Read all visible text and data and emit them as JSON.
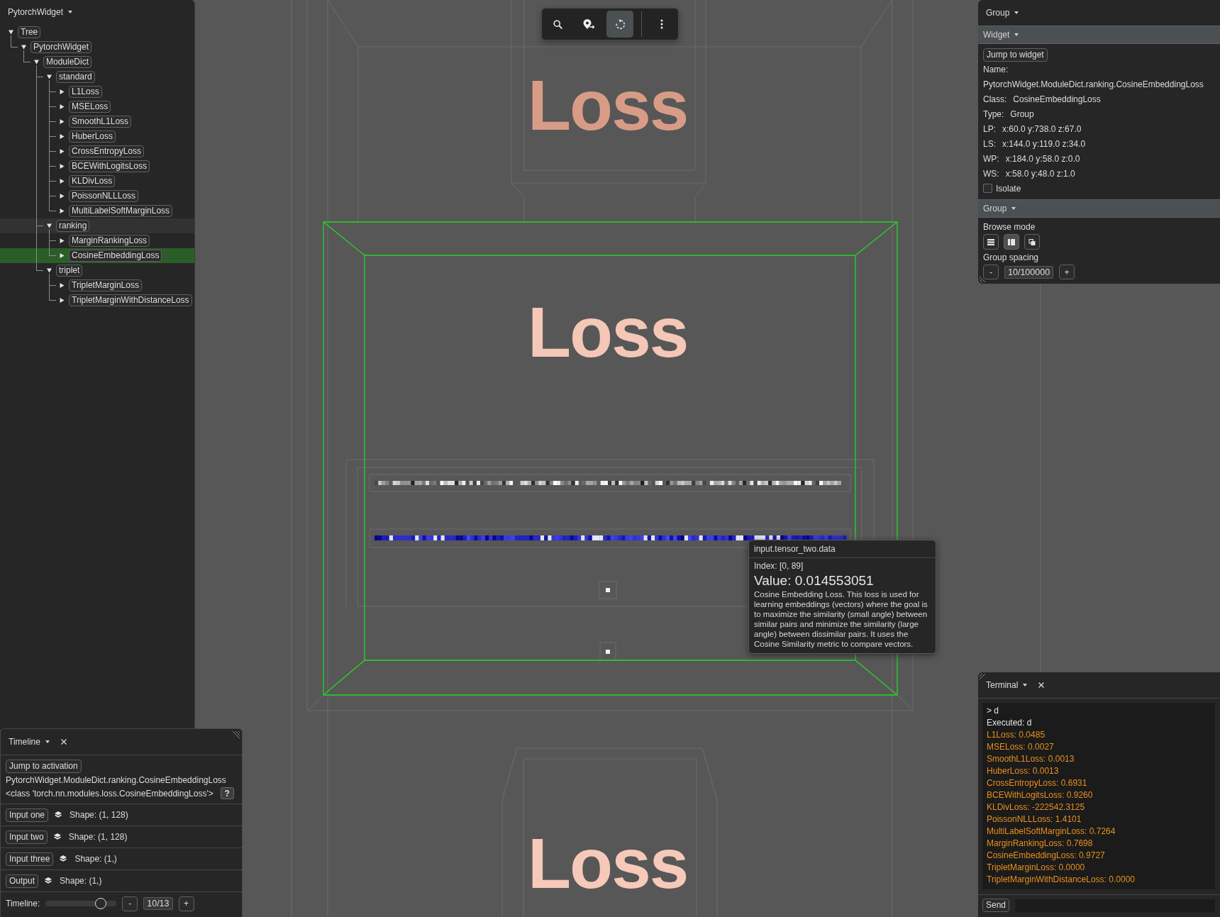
{
  "tree_panel": {
    "title": "PytorchWidget",
    "tree": [
      {
        "label": "Tree",
        "expanded": true,
        "selected": false,
        "hovered": false,
        "children": [
          {
            "label": "PytorchWidget",
            "expanded": true,
            "selected": false,
            "hovered": false,
            "children": [
              {
                "label": "ModuleDict",
                "expanded": true,
                "selected": false,
                "hovered": false,
                "children": [
                  {
                    "label": "standard",
                    "expanded": true,
                    "selected": false,
                    "hovered": false,
                    "children": [
                      {
                        "label": "L1Loss",
                        "expanded": false,
                        "selected": false,
                        "hovered": false
                      },
                      {
                        "label": "MSELoss",
                        "expanded": false,
                        "selected": false,
                        "hovered": false
                      },
                      {
                        "label": "SmoothL1Loss",
                        "expanded": false,
                        "selected": false,
                        "hovered": false
                      },
                      {
                        "label": "HuberLoss",
                        "expanded": false,
                        "selected": false,
                        "hovered": false
                      },
                      {
                        "label": "CrossEntropyLoss",
                        "expanded": false,
                        "selected": false,
                        "hovered": false
                      },
                      {
                        "label": "BCEWithLogitsLoss",
                        "expanded": false,
                        "selected": false,
                        "hovered": false
                      },
                      {
                        "label": "KLDivLoss",
                        "expanded": false,
                        "selected": false,
                        "hovered": false
                      },
                      {
                        "label": "PoissonNLLLoss",
                        "expanded": false,
                        "selected": false,
                        "hovered": false
                      },
                      {
                        "label": "MultiLabelSoftMarginLoss",
                        "expanded": false,
                        "selected": false,
                        "hovered": false
                      }
                    ]
                  },
                  {
                    "label": "ranking",
                    "expanded": true,
                    "selected": false,
                    "hovered": true,
                    "children": [
                      {
                        "label": "MarginRankingLoss",
                        "expanded": false,
                        "selected": false,
                        "hovered": false
                      },
                      {
                        "label": "CosineEmbeddingLoss",
                        "expanded": false,
                        "selected": true,
                        "hovered": false
                      }
                    ]
                  },
                  {
                    "label": "triplet",
                    "expanded": true,
                    "selected": false,
                    "hovered": false,
                    "children": [
                      {
                        "label": "TripletMarginLoss",
                        "expanded": false,
                        "selected": false,
                        "hovered": false
                      },
                      {
                        "label": "TripletMarginWithDistanceLoss",
                        "expanded": false,
                        "selected": false,
                        "hovered": false
                      }
                    ]
                  }
                ]
              }
            ]
          }
        ]
      }
    ]
  },
  "toolbar": {
    "tools": [
      {
        "selected": false
      },
      {
        "selected": false
      },
      {
        "selected": true
      }
    ]
  },
  "viewport": {
    "labels": [
      {
        "text": "Loss",
        "color": "#d89c86"
      },
      {
        "text": "Loss",
        "color": "#f4c7b7"
      },
      {
        "text": "Loss",
        "color": "#f6c9b9"
      }
    ],
    "tooltip": {
      "title": "input.tensor_two.data",
      "index": "Index: [0, 89]",
      "value": "Value: 0.014553051",
      "description": "Cosine Embedding Loss. This loss is used for learning embeddings (vectors) where the goal is to maximize the similarity (small angle) between similar pairs and minimize the similarity (large angle) between dissimilar pairs. It uses the Cosine Similarity metric to compare vectors."
    }
  },
  "inspector": {
    "title": "Group",
    "widget_section": {
      "title": "Widget",
      "expanded": true,
      "jump_button": "Jump to widget",
      "name_label": "Name:",
      "name_value": "PytorchWidget.ModuleDict.ranking.CosineEmbeddingLoss",
      "properties": [
        {
          "label": "Class:",
          "value": "CosineEmbeddingLoss"
        },
        {
          "label": "Type:",
          "value": "Group"
        },
        {
          "label": "LP:",
          "value": "x:60.0 y:738.0 z:67.0"
        },
        {
          "label": "LS:",
          "value": "x:144.0 y:119.0 z:34.0"
        },
        {
          "label": "WP:",
          "value": "x:184.0 y:58.0 z:0.0"
        },
        {
          "label": "WS:",
          "value": "x:58.0 y:48.0 z:1.0"
        }
      ],
      "isolate": {
        "label": "Isolate",
        "checked": false
      }
    },
    "group_section": {
      "title": "Group",
      "expanded": true,
      "browse_mode_label": "Browse mode",
      "browse_modes": [
        {
          "selected": false
        },
        {
          "selected": true
        },
        {
          "selected": false
        }
      ],
      "spacing_label": "Group spacing",
      "spacing_decrement": "-",
      "spacing_value": "10/100000",
      "spacing_increment": "+"
    }
  },
  "timeline": {
    "title": "Timeline",
    "jump_button": "Jump to activation",
    "module_path": "PytorchWidget.ModuleDict.ranking.CosineEmbeddingLoss",
    "class_text": "<class 'torch.nn.modules.loss.CosineEmbeddingLoss'>",
    "help_button": "?",
    "tensors": [
      {
        "button": "Input one",
        "shape": "Shape: (1, 128)"
      },
      {
        "button": "Input two",
        "shape": "Shape: (1, 128)"
      },
      {
        "button": "Input three",
        "shape": "Shape: (1,)"
      },
      {
        "button": "Output",
        "shape": "Shape: (1,)"
      }
    ],
    "slider": {
      "label": "Timeline:",
      "level": 0.78,
      "decrement": "-",
      "value": "10/13",
      "increment": "+"
    }
  },
  "terminal": {
    "title": "Terminal",
    "lines": [
      {
        "kind": "command",
        "text": "> d"
      },
      {
        "kind": "info",
        "text": "Executed: d"
      },
      {
        "kind": "result",
        "text": "L1Loss: 0.0485"
      },
      {
        "kind": "result",
        "text": "MSELoss: 0.0027"
      },
      {
        "kind": "result",
        "text": "SmoothL1Loss: 0.0013"
      },
      {
        "kind": "result",
        "text": "HuberLoss: 0.0013"
      },
      {
        "kind": "result",
        "text": "CrossEntropyLoss: 0.6931"
      },
      {
        "kind": "result",
        "text": "BCEWithLogitsLoss: 0.9260"
      },
      {
        "kind": "result",
        "text": "KLDivLoss: -222542.3125"
      },
      {
        "kind": "result",
        "text": "PoissonNLLLoss: 1.4101"
      },
      {
        "kind": "result",
        "text": "MultiLabelSoftMarginLoss: 0.7264"
      },
      {
        "kind": "result",
        "text": "MarginRankingLoss: 0.7698"
      },
      {
        "kind": "result",
        "text": "CosineEmbeddingLoss: 0.9727"
      },
      {
        "kind": "result",
        "text": "TripletMarginLoss: 0.0000"
      },
      {
        "kind": "result",
        "text": "TripletMarginWithDistanceLoss: 0.0000"
      }
    ],
    "send_button": "Send"
  }
}
